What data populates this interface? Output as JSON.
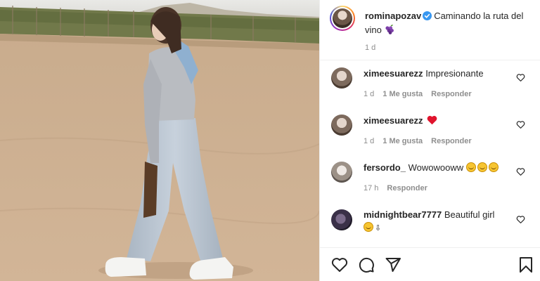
{
  "post": {
    "username": "rominapozav",
    "caption": "Caminando la ruta del vino",
    "time": "1 d",
    "caption_emoji": "grapes-icon"
  },
  "comments": [
    {
      "username": "ximeesuarezz",
      "text": "Impresionante",
      "time": "1 d",
      "likes": "1 Me gusta",
      "reply": "Responder"
    },
    {
      "username": "ximeesuarezz",
      "text": "",
      "emoji": "red-heart-emoji",
      "time": "1 d",
      "likes": "1 Me gusta",
      "reply": "Responder"
    },
    {
      "username": "fersordo_",
      "text": "Wowowooww",
      "emoji": "smiling-face-emoji",
      "time": "17 h",
      "reply": "Responder"
    },
    {
      "username": "midnightbear7777",
      "text": "Beautiful girl",
      "emoji": "smiling-face-emoji",
      "time": "",
      "reply": ""
    }
  ],
  "colors": {
    "verified": "#3897f0",
    "text": "#262626",
    "muted": "#8e8e8e",
    "heart": "#ed4956"
  },
  "actions": [
    "heart-icon",
    "comment-icon",
    "share-icon",
    "bookmark-icon"
  ]
}
